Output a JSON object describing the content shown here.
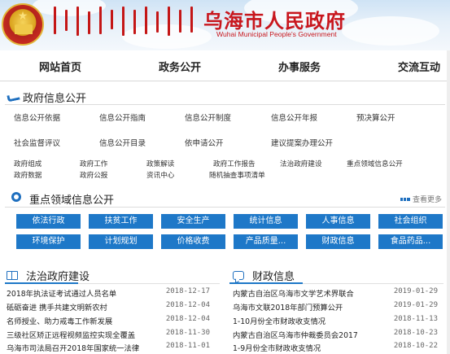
{
  "header": {
    "title": "乌海市人民政府",
    "subtitle": "Wuhai Municipal People's Government",
    "emblem_icon": "national-emblem-icon",
    "mongolian_script_icon": "mongolian-script-title"
  },
  "nav": {
    "items": [
      {
        "label": "网站首页"
      },
      {
        "label": "政务公开"
      },
      {
        "label": "办事服务"
      },
      {
        "label": "交流互动"
      }
    ]
  },
  "info_public": {
    "title": "政府信息公开",
    "row1": [
      "信息公开依据",
      "信息公开指南",
      "信息公开制度",
      "信息公开年报",
      "预决算公开"
    ],
    "row2": [
      "社会监督评议",
      "信息公开目录",
      "依申请公开",
      "建议提案办理公开"
    ],
    "row3": [
      "政府组成",
      "政府工作",
      "政策解读",
      "政府工作报告",
      "法治政府建设",
      "重点领域信息公开"
    ],
    "row4": [
      "政府数据",
      "政府公报",
      "资讯中心",
      "随机抽查事项清单"
    ]
  },
  "key_areas": {
    "title": "重点领域信息公开",
    "more_label": "查看更多",
    "buttons_row1": [
      "依法行政",
      "扶贫工作",
      "安全生产",
      "统计信息",
      "人事信息",
      "社会组织"
    ],
    "buttons_row2": [
      "环境保护",
      "计划规划",
      "价格收费",
      "产品质量...",
      "财政信息",
      "食品药品..."
    ],
    "button_color": "#1e78c8"
  },
  "law_column": {
    "title": "法治政府建设",
    "items": [
      {
        "title": "2018年执法证考试通过人员名单",
        "date": "2018-12-17"
      },
      {
        "title": "砥砺奋进 携手共建文明新农村",
        "date": "2018-12-04"
      },
      {
        "title": "名师授业、助力戒毒工作新发展",
        "date": "2018-12-04"
      },
      {
        "title": "三级社区矫正远程视频监控实现全覆盖",
        "date": "2018-11-30"
      },
      {
        "title": "乌海市司法局召开2018年国家统一法律",
        "date": "2018-11-01"
      }
    ]
  },
  "finance_column": {
    "title": "财政信息",
    "items": [
      {
        "title": "内蒙古自治区乌海市文学艺术界联合",
        "date": "2019-01-29"
      },
      {
        "title": "乌海市文联2018年部门预算公开",
        "date": "2019-01-29"
      },
      {
        "title": "1-10月份全市财政收支情况",
        "date": "2018-11-13"
      },
      {
        "title": "内蒙古自治区乌海市仲裁委员会2017",
        "date": "2018-10-23"
      },
      {
        "title": "1-9月份全市财政收支情况",
        "date": "2018-10-22"
      }
    ]
  },
  "colors": {
    "brand_red": "#c8161d",
    "accent_blue": "#1e78c8"
  }
}
